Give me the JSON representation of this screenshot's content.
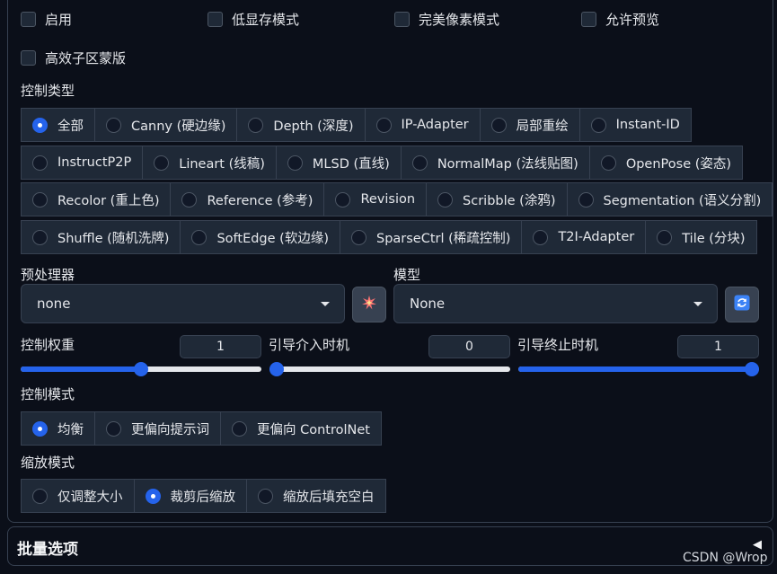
{
  "checkboxes": {
    "enable": "启用",
    "low_vram": "低显存模式",
    "pixel_perfect": "完美像素模式",
    "allow_preview": "允许预览",
    "effective_region_mask": "高效子区蒙版"
  },
  "control_type": {
    "label": "控制类型",
    "selected": "全部",
    "rows": [
      [
        "全部",
        "Canny (硬边缘)",
        "Depth (深度)",
        "IP-Adapter",
        "局部重绘",
        "Instant-ID"
      ],
      [
        "InstructP2P",
        "Lineart (线稿)",
        "MLSD (直线)",
        "NormalMap (法线贴图)",
        "OpenPose (姿态)"
      ],
      [
        "Recolor (重上色)",
        "Reference (参考)",
        "Revision",
        "Scribble (涂鸦)",
        "Segmentation (语义分割)"
      ],
      [
        "Shuffle (随机洗牌)",
        "SoftEdge (软边缘)",
        "SparseCtrl (稀疏控制)",
        "T2I-Adapter",
        "Tile (分块)"
      ]
    ]
  },
  "preprocessor": {
    "label": "预处理器",
    "value": "none",
    "icon": "explosion-icon"
  },
  "model": {
    "label": "模型",
    "value": "None",
    "icon": "refresh-icon"
  },
  "sliders": {
    "weight": {
      "label": "控制权重",
      "value": "1",
      "fraction": 0.5
    },
    "start": {
      "label": "引导介入时机",
      "value": "0",
      "fraction": 0.0
    },
    "end": {
      "label": "引导终止时机",
      "value": "1",
      "fraction": 1.0
    }
  },
  "control_mode": {
    "label": "控制模式",
    "options": [
      "均衡",
      "更偏向提示词",
      "更偏向 ControlNet"
    ],
    "selected": "均衡"
  },
  "resize_mode": {
    "label": "缩放模式",
    "options": [
      "仅调整大小",
      "裁剪后缩放",
      "缩放后填充空白"
    ],
    "selected": "裁剪后缩放"
  },
  "batch": {
    "title": "批量选项",
    "arrow": "◀"
  },
  "watermark": "CSDN @Wrop",
  "colors": {
    "accent": "#2563eb",
    "background": "#0b0f19",
    "surface": "#1f2937"
  }
}
